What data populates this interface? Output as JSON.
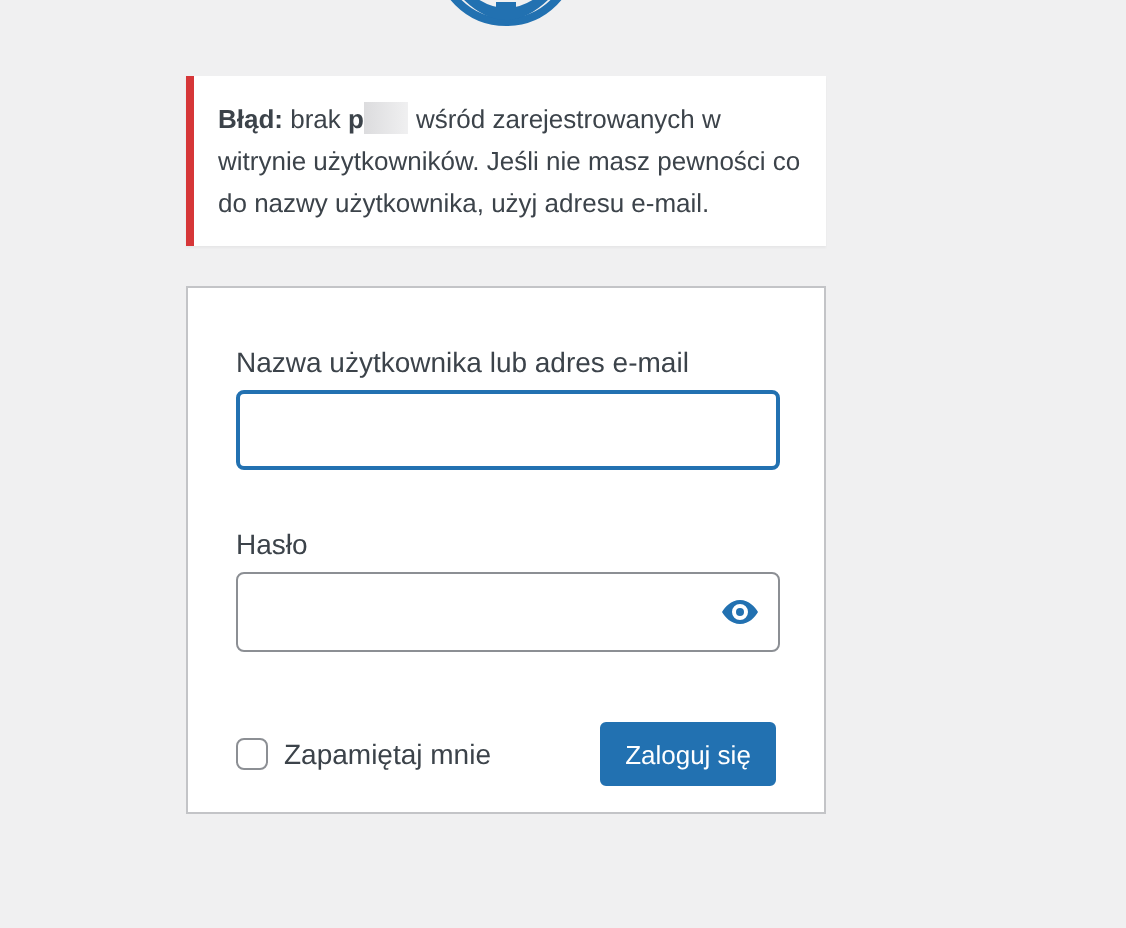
{
  "error_notice": {
    "text": "**Błąd:** brak **p**",
    "text_after": "wśród zarejestrowanych w witrynie użytkowników. Jeśli nie masz pewności co do nazwy użytkownika, użyj adresu e-mail.",
    "redacted": true
  },
  "login_form": {
    "username": {
      "label": "Nazwa użytkownika lub adres e-mail",
      "focused": true
    },
    "password": {
      "label": "Hasło"
    },
    "remember": {
      "label": "Zapamiętaj mnie",
      "checked": false
    },
    "submit": "Zaloguj się"
  }
}
